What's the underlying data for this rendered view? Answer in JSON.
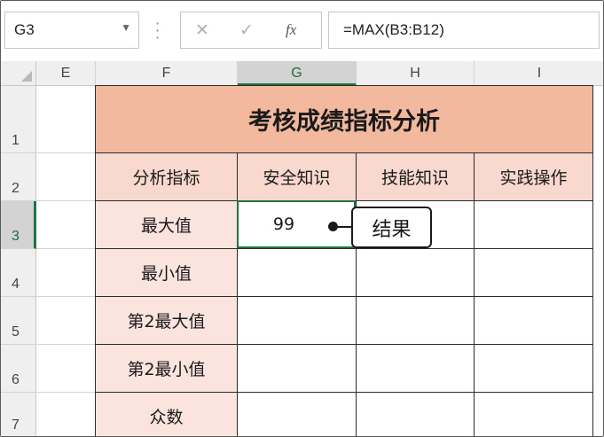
{
  "formula_bar": {
    "name_box": "G3",
    "name_box_arrow": "▼",
    "cancel_glyph": "✕",
    "enter_glyph": "✓",
    "function_glyph": "fx",
    "formula": "=MAX(B3:B12)"
  },
  "columns": [
    "E",
    "F",
    "G",
    "H",
    "I"
  ],
  "rows": [
    "1",
    "2",
    "3",
    "4",
    "5",
    "6",
    "7"
  ],
  "selected_cell": "G3",
  "table": {
    "title": "考核成绩指标分析",
    "header": [
      "分析指标",
      "安全知识",
      "技能知识",
      "实践操作"
    ],
    "row_labels": [
      "最大值",
      "最小值",
      "第2最大值",
      "第2最小值",
      "众数"
    ],
    "values": {
      "G3": "99"
    }
  },
  "callout": "结果",
  "colors": {
    "title_fill": "#f3b99f",
    "header_fill": "#f9d8cf",
    "label_fill": "#fbe4dd",
    "selection": "#217346"
  }
}
